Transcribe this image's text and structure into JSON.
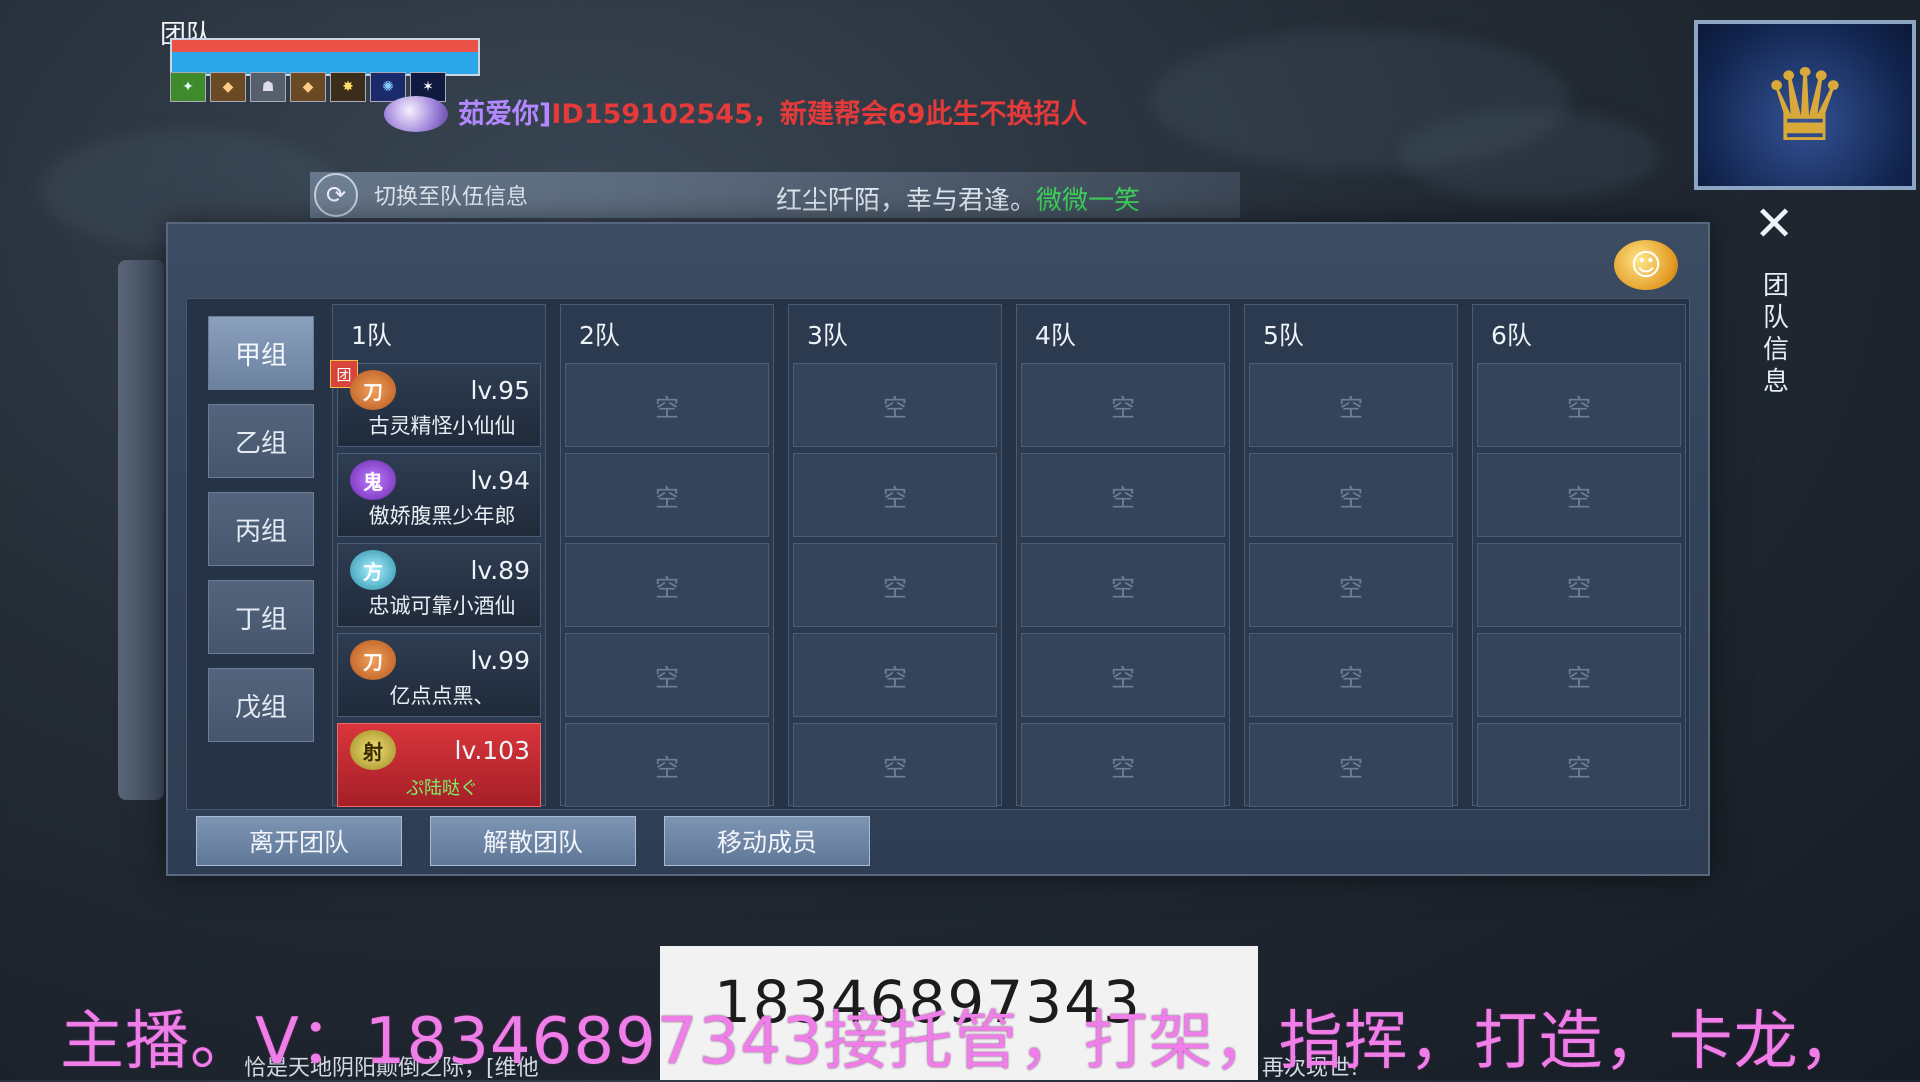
{
  "hud": {
    "title": "团队",
    "buffs": [
      "✦",
      "◆",
      "☗",
      "◆",
      "✸",
      "✺",
      "✶"
    ]
  },
  "chat": {
    "name": "茹爱你]",
    "message": "ID159102545，新建帮会69此生不换招人"
  },
  "switch_bar": {
    "label": "切换至队伍信息",
    "marquee_a": "红尘阡陌，幸与君逢。",
    "marquee_b": "微微一笑"
  },
  "side_panel": {
    "close": "✕",
    "label": "团队信息"
  },
  "groups": [
    "甲组",
    "乙组",
    "丙组",
    "丁组",
    "戊组"
  ],
  "active_group": "甲组",
  "teams": [
    {
      "label": "1队",
      "members": [
        {
          "sect": "刀",
          "level": "lv.95",
          "name": "古灵精怪小仙仙",
          "leader_badge": "团"
        },
        {
          "sect": "鬼",
          "level": "lv.94",
          "name": "傲娇腹黑少年郎"
        },
        {
          "sect": "方",
          "level": "lv.89",
          "name": "忠诚可靠小酒仙"
        },
        {
          "sect": "刀",
          "level": "lv.99",
          "name": "亿点点黑、"
        },
        {
          "sect": "射",
          "level": "lv.103",
          "name": "ぷ陆哒ぐ"
        }
      ]
    },
    {
      "label": "2队",
      "slots": [
        "空",
        "空",
        "空",
        "空",
        "空"
      ]
    },
    {
      "label": "3队",
      "slots": [
        "空",
        "空",
        "空",
        "空",
        "空"
      ]
    },
    {
      "label": "4队",
      "slots": [
        "空",
        "空",
        "空",
        "空",
        "空"
      ]
    },
    {
      "label": "5队",
      "slots": [
        "空",
        "空",
        "空",
        "空",
        "空"
      ]
    },
    {
      "label": "6队",
      "slots": [
        "空",
        "空",
        "空",
        "空",
        "空"
      ]
    }
  ],
  "actions": {
    "leave": "离开团队",
    "disband": "解散团队",
    "move": "移动成员"
  },
  "bottom": {
    "phone": "18346897343",
    "ticker_left": "恰是天地阴阳颠倒之际，[维他",
    "ticker_right": "再次现世!",
    "caption": "主播。V：18346897343接托管，打架，指挥，打造，卡龙，"
  },
  "colors": {
    "selected_member": "#d8353b",
    "chat_name": "#b388ff",
    "chat_message": "#e53a3a",
    "marquee_green": "#3ed45b",
    "caption": "#f07ee8"
  }
}
